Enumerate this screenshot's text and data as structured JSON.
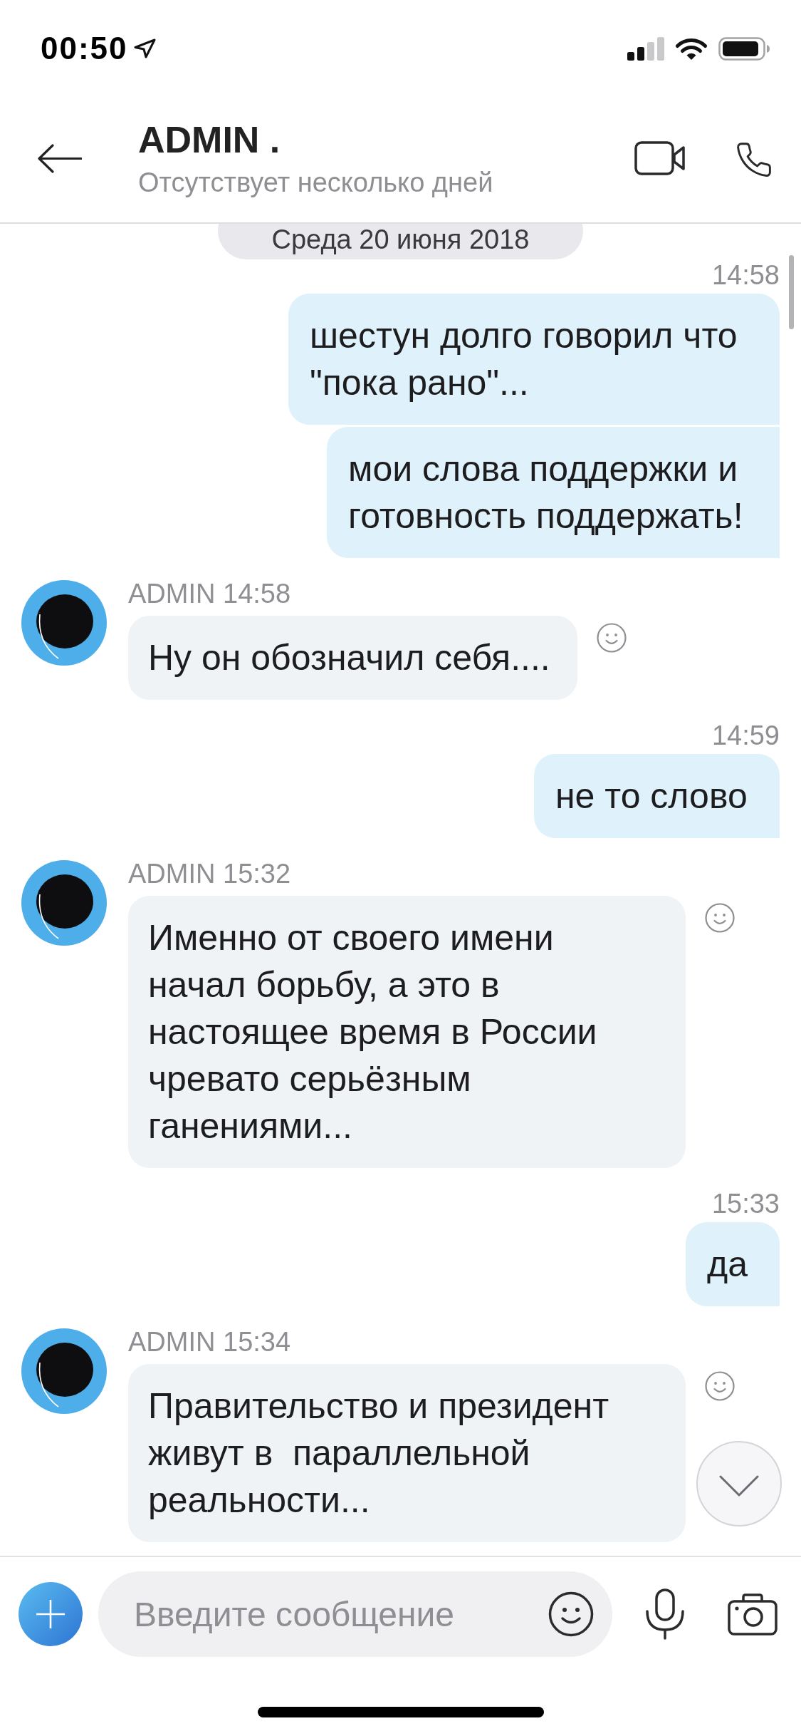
{
  "status_bar": {
    "time": "00:50"
  },
  "header": {
    "title": "ADMIN .",
    "subtitle": "Отсутствует несколько дней"
  },
  "date_divider": "Среда 20 июня 2018",
  "messages": [
    {
      "kind": "outgoing",
      "time": "14:58",
      "bubbles": [
        "шестун долго говорил что \"пока рано\"...",
        "мои слова поддержки и готовность поддержать!"
      ]
    },
    {
      "kind": "incoming",
      "sender": "ADMIN",
      "time": "14:58",
      "bubbles": [
        "Ну он обозначил себя...."
      ]
    },
    {
      "kind": "outgoing",
      "time": "14:59",
      "bubbles": [
        "не то слово"
      ]
    },
    {
      "kind": "incoming",
      "sender": "ADMIN",
      "time": "15:32",
      "bubbles": [
        "Именно от своего имени начал борьбу, а это в настоящее время в России чревато серьёзным ганениями..."
      ]
    },
    {
      "kind": "outgoing",
      "time": "15:33",
      "bubbles": [
        "да"
      ]
    },
    {
      "kind": "incoming",
      "sender": "ADMIN",
      "time": "15:34",
      "bubbles": [
        "Правительство и президент живут в  параллельной реальности..."
      ]
    }
  ],
  "composer": {
    "placeholder": "Введите сообщение"
  }
}
